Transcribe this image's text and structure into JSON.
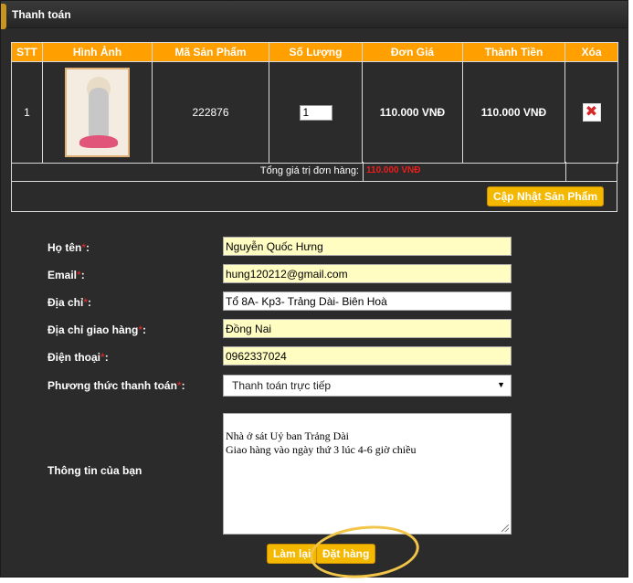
{
  "panel": {
    "title": "Thanh toán"
  },
  "cart": {
    "headers": [
      "STT",
      "Hình Ảnh",
      "Mã Sản Phẩm",
      "Số Lượng",
      "Đơn Giá",
      "Thành Tiền",
      "Xóa"
    ],
    "rows": [
      {
        "stt": "1",
        "image": "guanyin-cross-stitch-thumbnail",
        "code": "222876",
        "quantity": "1",
        "unit_price": "110.000 VNĐ",
        "line_total": "110.000 VNĐ",
        "delete_icon": "red-x-icon"
      }
    ],
    "total_label": "Tổng giá trị đơn hàng:",
    "total_value": "110.000 VNĐ",
    "update_button": "Cập Nhật Sản Phẩm"
  },
  "form": {
    "name_label": "Họ tên",
    "name_value": "Nguyễn Quốc Hưng",
    "email_label": "Email",
    "email_value": "hung120212@gmail.com",
    "address_label": "Địa chỉ",
    "address_value": "Tổ 8A- Kp3- Trảng Dài- Biên Hoà",
    "shipping_label": "Địa chỉ giao hàng",
    "shipping_value": "Đồng Nai",
    "phone_label": "Điện thoại",
    "phone_value": "0962337024",
    "payment_label": "Phương thức thanh toán",
    "payment_value": "Thanh toán trực tiếp",
    "info_label": "Thông tin của bạn",
    "info_value": "Nhà ở sát Uỷ ban Trảng Dài\nGiao hàng vào ngày thứ 3 lúc 4-6 giờ chiều",
    "required_mark": "*",
    "colon": ":",
    "reset_button": "Làm lại",
    "order_button": "Đặt hàng"
  },
  "colors": {
    "accent": "#ff9f00",
    "button": "#f5b800",
    "price": "#ee1c1c",
    "background": "#2b2b2b",
    "highlight": "#f2c548"
  }
}
